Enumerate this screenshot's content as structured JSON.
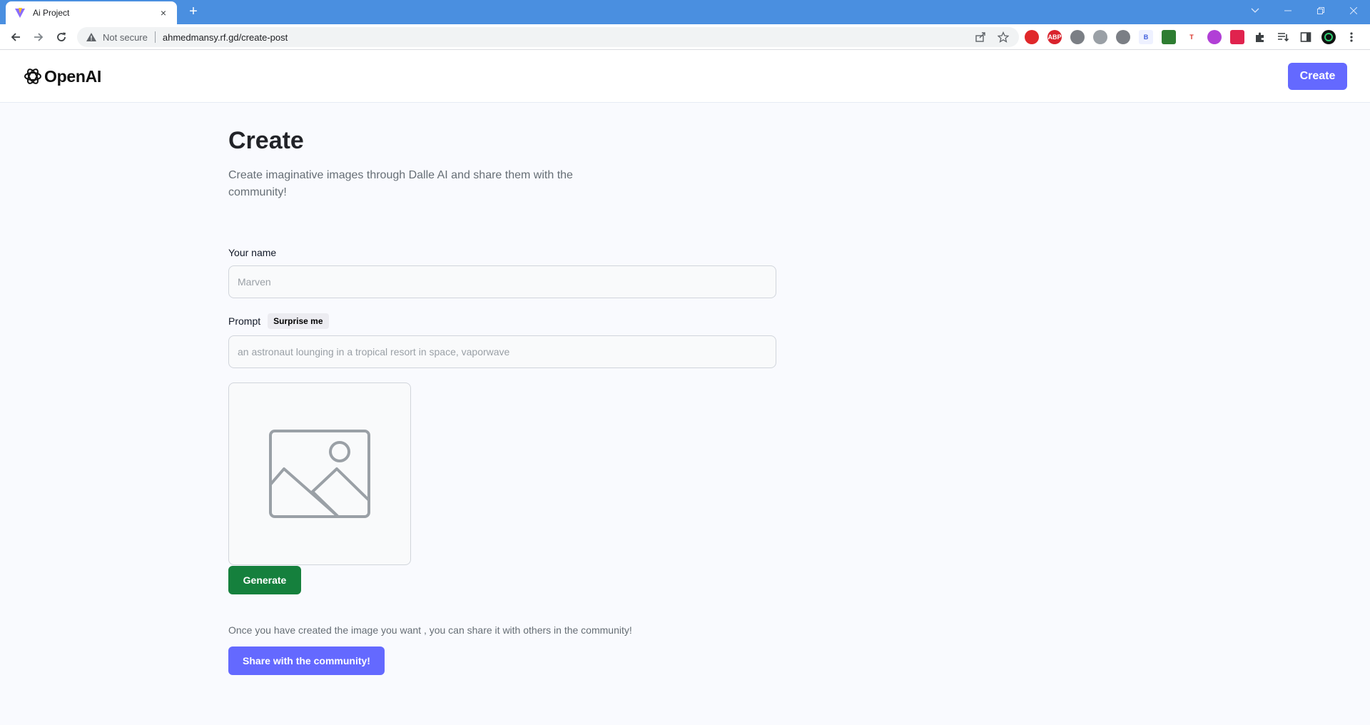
{
  "browser": {
    "tab_title": "Ai Project",
    "tab_close": "×",
    "new_tab": "+",
    "security_label": "Not secure",
    "url": "ahmedmansy.rf.gd/create-post",
    "extensions": [
      {
        "name": "opera-extension",
        "color": "#e0282a",
        "text": ""
      },
      {
        "name": "adblock-plus-extension",
        "color": "#d9232d",
        "text": "ABP"
      },
      {
        "name": "record-extension",
        "color": "#7b7f85",
        "text": ""
      },
      {
        "name": "cloud-extension",
        "color": "#9aa0a6",
        "text": ""
      },
      {
        "name": "bug-extension",
        "color": "#7b7f85",
        "text": ""
      },
      {
        "name": "b-extension",
        "color": "#eef1ff",
        "text": "B"
      },
      {
        "name": "tree-extension",
        "color": "#2e7d32",
        "text": ""
      },
      {
        "name": "t-extension",
        "color": "#ffffff",
        "text": "T"
      },
      {
        "name": "emoji-extension",
        "color": "#b13fd6",
        "text": ""
      },
      {
        "name": "pause-extension",
        "color": "#e0234e",
        "text": ""
      }
    ]
  },
  "header": {
    "logo_text": "OpenAI",
    "create_label": "Create"
  },
  "main": {
    "title": "Create",
    "subtitle": "Create imaginative images through Dalle AI and share them with the community!",
    "name_label": "Your name",
    "name_placeholder": "Marven",
    "prompt_label": "Prompt",
    "surprise_label": "Surprise me",
    "prompt_placeholder": "an astronaut lounging in a tropical resort in space, vaporwave",
    "generate_label": "Generate",
    "share_note": "Once you have created the image you want , you can share it with others in the community!",
    "share_label": "Share with the community!"
  },
  "colors": {
    "tabbar": "#4a8fe0",
    "brand": "#6469ff",
    "generate": "#15803d"
  }
}
